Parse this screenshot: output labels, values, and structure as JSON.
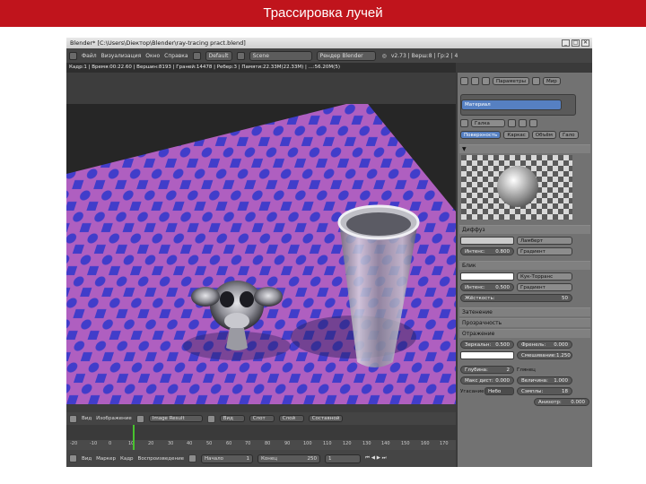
{
  "slide": {
    "title": "Трассировка лучей"
  },
  "window": {
    "title": "Blender* [C:\\Users\\Diектор\\Blender\\ray-tracing pract.blend]"
  },
  "menubar": {
    "menus": [
      "Файл",
      "Визуализация",
      "Окно",
      "Справка"
    ],
    "layout": "Default",
    "scene": "Scene",
    "engine": "Рендер Blender",
    "version": "v2.73 | Верш:8 | Гр:2 | 4"
  },
  "viewport": {
    "info": "Кадр:1 | Время:00:22.60 | Вершин:8193 | Граней:14478 | Ребер:3 | Памяти:22.33M(22.33M) | ...:56.20M(5)"
  },
  "timeline": {
    "menus": [
      "Вид",
      "Маркер",
      "Кадр",
      "Воспроизведение"
    ],
    "ticks": [
      "-20",
      "-10",
      "0",
      "10",
      "20",
      "30",
      "40",
      "50",
      "60",
      "70",
      "80",
      "90",
      "100",
      "110",
      "120",
      "130",
      "140",
      "150",
      "160",
      "170"
    ],
    "start_label": "Начало",
    "start_value": "1",
    "end_label": "Конец",
    "end_value": "250",
    "current_frame": "1"
  },
  "view_header": {
    "items": [
      "Вид",
      "Изображение",
      "Image Result",
      "Вид",
      "Слот",
      "Слой",
      "Составной"
    ]
  },
  "properties": {
    "tabs": [
      "Параметры",
      "Мир"
    ],
    "material_name": "Материал",
    "world_name": "Галка",
    "preview_tabs": [
      "Поверхность",
      "Каркас",
      "Объём",
      "Гало"
    ],
    "diffuse": {
      "header": "Диффуз",
      "shader": "Ламберт",
      "intensity_label": "Интенс:",
      "intensity_value": "0.800",
      "ramp_label": "Градиент"
    },
    "specular": {
      "header": "Блик",
      "shader": "Кук-Торранс",
      "intensity_label": "Интенс:",
      "intensity_value": "0.500",
      "ramp_label": "Градиент",
      "hardness_label": "Жёсткость:",
      "hardness_value": "50"
    },
    "shading_header": "Затенение",
    "transparency_header": "Прозрачность",
    "mirror": {
      "header": "Отражение",
      "reflect_label": "Зеркальн:",
      "reflect_value": "0.500",
      "fresnel_label": "Френель:",
      "fresnel_value": "0.000",
      "blend_label": "Смешивание:",
      "blend_value": "1.250",
      "depth_label": "Глубина:",
      "depth_value": "2",
      "max_dist_label": "Макс дист:",
      "max_dist_value": "0.000",
      "fade_label": "Угасание:",
      "fade_value": "Небо",
      "gloss_label": "Глянец",
      "gloss_amount_label": "Величина:",
      "gloss_amount_value": "1.000",
      "samples_label": "Сэмплы:",
      "samples_value": "18",
      "aniso_label": "Анизотр:",
      "aniso_value": "0.000"
    }
  },
  "colors": {
    "accent_red": "#c0141c",
    "floor_magenta": "#c86ddb",
    "floor_blue": "#4a46e6",
    "timeline_cursor": "#48c22e",
    "selection_blue": "#5680c2"
  }
}
